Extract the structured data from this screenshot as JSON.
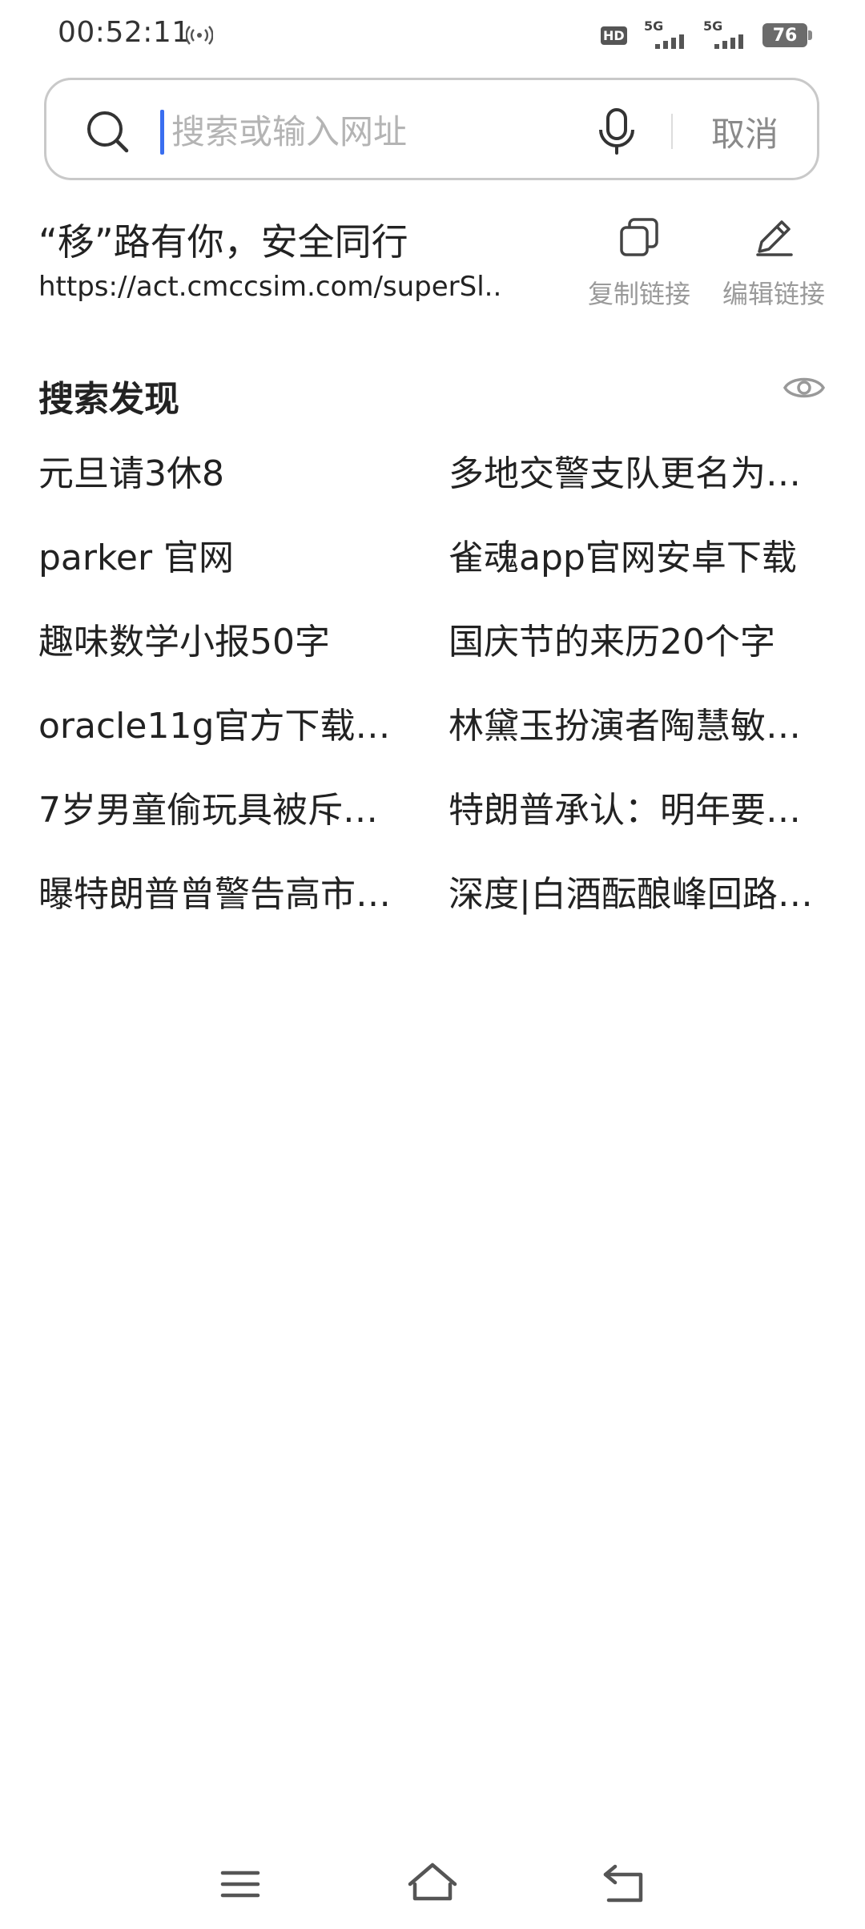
{
  "status_bar": {
    "time": "00:52:11",
    "hd_label": "HD",
    "network_1": "5G",
    "network_2": "5G",
    "battery": "76"
  },
  "search": {
    "placeholder": "搜索或输入网址",
    "cancel_label": "取消"
  },
  "clipboard": {
    "title": "“移”路有你，安全同行",
    "url": "https://act.cmccsim.com/superSl...",
    "copy_label": "复制链接",
    "edit_label": "编辑链接"
  },
  "discovery": {
    "title": "搜索发现",
    "items": [
      "元旦请3休8",
      "多地交警支队更名为…",
      "parker 官网",
      "雀魂app官网安卓下载",
      "趣味数学小报50字",
      "国庆节的来历20个字",
      "oracle11g官方下载…",
      "林黛玉扮演者陶慧敏…",
      "7岁男童偷玩具被斥…",
      "特朗普承认：明年要…",
      "曝特朗普曾警告高市…",
      "深度|白酒酝酿峰回路…"
    ]
  },
  "colors": {
    "accent_caret": "#3a6ef0",
    "muted_text": "#9a9a9a",
    "border": "#c9c9c9"
  },
  "icons": {
    "search": "search-icon",
    "mic": "mic-icon",
    "copy": "copy-icon",
    "edit": "pencil-icon",
    "eye": "eye-icon",
    "nav_menu": "menu-icon",
    "nav_home": "home-icon",
    "nav_back": "back-icon"
  }
}
